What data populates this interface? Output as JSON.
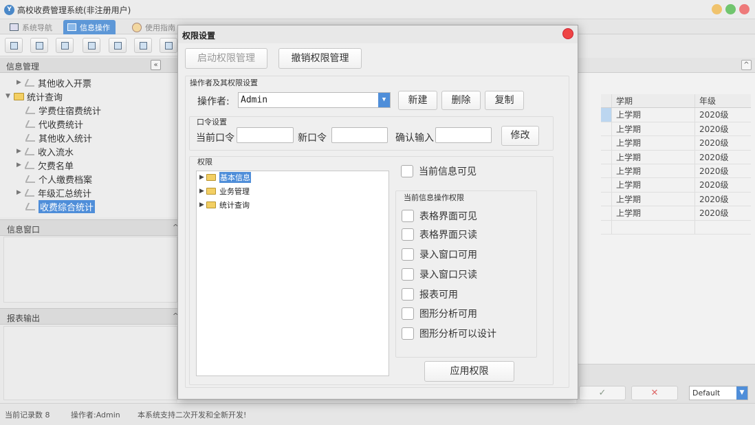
{
  "window": {
    "title": "高校收费管理系统(非注册用户)",
    "logo": "Y"
  },
  "tabs": [
    {
      "label": "系统导航",
      "icon": "monitor-icon"
    },
    {
      "label": "信息操作",
      "icon": "grid-icon"
    },
    {
      "label": "使用指南",
      "icon": "help-icon"
    }
  ],
  "left": {
    "header": "信息管理",
    "collapse": "«",
    "tree": [
      {
        "label": "其他收入开票",
        "type": "leaf-parent"
      },
      {
        "label": "统计查询",
        "type": "folder-open"
      },
      {
        "label": "学费住宿费统计",
        "type": "leaf"
      },
      {
        "label": "代收费统计",
        "type": "leaf"
      },
      {
        "label": "其他收入统计",
        "type": "leaf"
      },
      {
        "label": "收入流水",
        "type": "leaf-parent"
      },
      {
        "label": "欠费名单",
        "type": "leaf-parent"
      },
      {
        "label": "个人缴费档案",
        "type": "leaf"
      },
      {
        "label": "年级汇总统计",
        "type": "leaf-parent"
      },
      {
        "label": "收费综合统计",
        "type": "leaf-selected"
      }
    ],
    "info_window": "信息窗口",
    "report_output": "报表输出",
    "section_toggle": "^"
  },
  "grid": {
    "headers": [
      "学期",
      "年级"
    ],
    "rows": [
      [
        "上学期",
        "2020级"
      ],
      [
        "上学期",
        "2020级"
      ],
      [
        "上学期",
        "2020级"
      ],
      [
        "上学期",
        "2020级"
      ],
      [
        "上学期",
        "2020级"
      ],
      [
        "上学期",
        "2020级"
      ],
      [
        "上学期",
        "2020级"
      ],
      [
        "上学期",
        "2020级"
      ]
    ],
    "toggle": "^"
  },
  "bottom": {
    "ok": "✓",
    "cancel": "✕",
    "style_select": "Default"
  },
  "status": {
    "records": "当前记录数 8",
    "operator": "操作者:Admin",
    "note": "本系统支持二次开发和全新开发!"
  },
  "dialog": {
    "title": "权限设置",
    "enable_button": "启动权限管理",
    "revoke_button": "撤销权限管理",
    "operator_group": "操作者及其权限设置",
    "operator_label": "操作者:",
    "operator_value": "Admin",
    "new_button": "新建",
    "delete_button": "删除",
    "copy_button": "复制",
    "password_group": "口令设置",
    "current_pw_label": "当前口令",
    "new_pw_label": "新口令",
    "confirm_pw_label": "确认输入",
    "modify_button": "修改",
    "permission_group": "权限",
    "perm_tree": [
      {
        "label": "基本信息",
        "selected": true
      },
      {
        "label": "业务管理",
        "selected": false
      },
      {
        "label": "统计查询",
        "selected": false
      }
    ],
    "current_visible": "当前信息可见",
    "op_group": "当前信息操作权限",
    "checks": [
      "表格界面可见",
      "表格界面只读",
      "录入窗口可用",
      "录入窗口只读",
      "报表可用",
      "图形分析可用",
      "图形分析可以设计"
    ],
    "apply_button": "应用权限"
  },
  "colors": {
    "accent": "#4f8ed9",
    "close": "#ee4444"
  }
}
